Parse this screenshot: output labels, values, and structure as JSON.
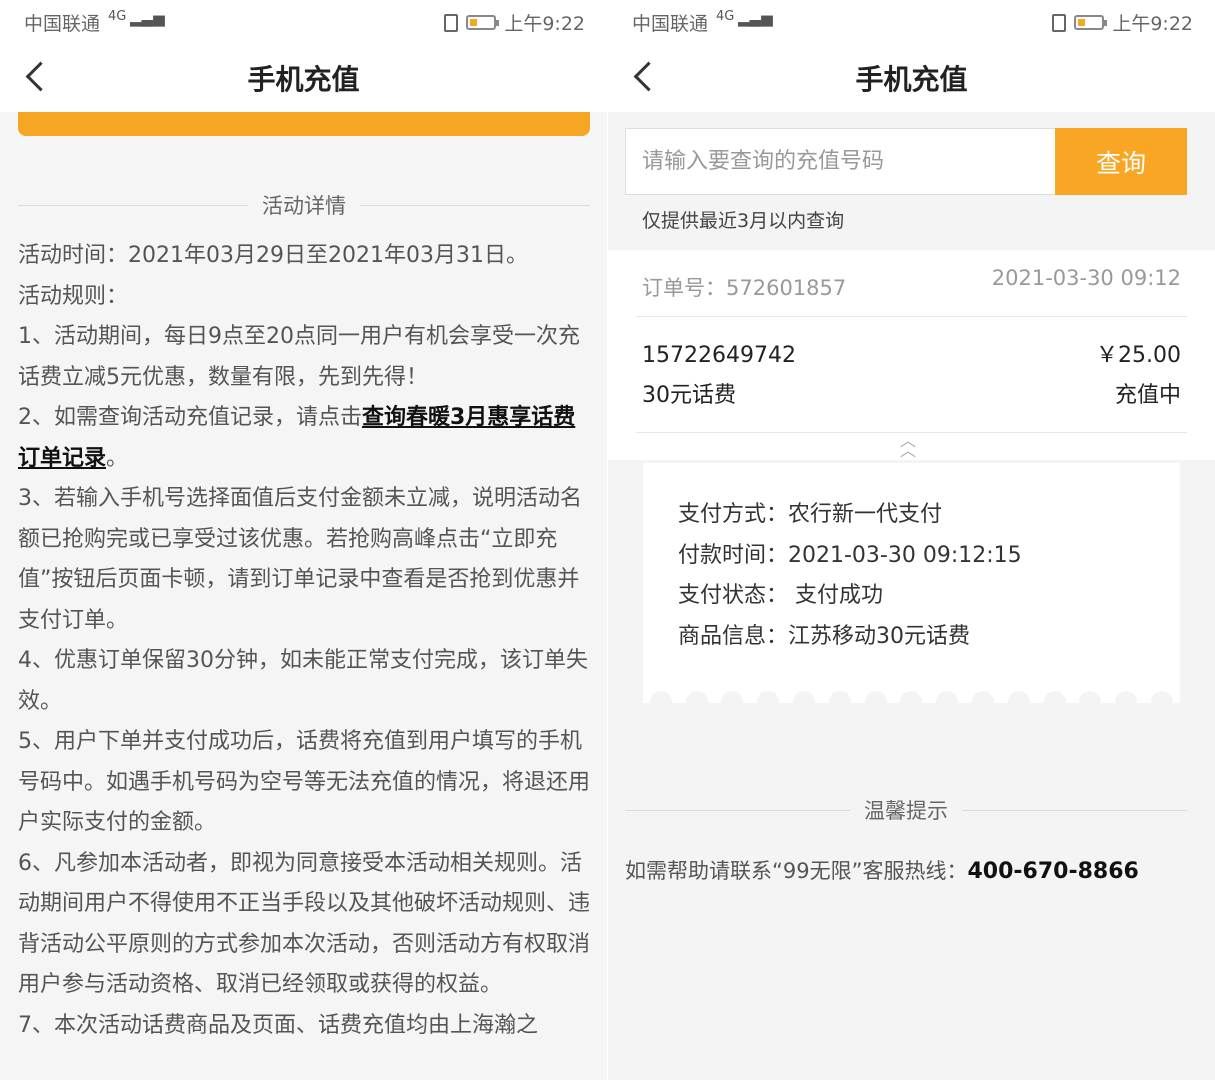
{
  "left": {
    "status": {
      "carrier": "中国联通",
      "signal": "4G",
      "time": "上午9:22"
    },
    "title": "手机充值",
    "section_title": "活动详情",
    "rules": {
      "line1": "活动时间：2021年03月29日至2021年03月31日。",
      "line2": "活动规则：",
      "rule1": "1、活动期间，每日9点至20点同一用户有机会享受一次充话费立减5元优惠，数量有限，先到先得！",
      "rule2_pre": "2、如需查询活动充值记录，请点击",
      "rule2_link": "查询春暖3月惠享话费订单记录",
      "rule2_post": "。",
      "rule3": "3、若输入手机号选择面值后支付金额未立减，说明活动名额已抢购完或已享受过该优惠。若抢购高峰点击“立即充值”按钮后页面卡顿，请到订单记录中查看是否抢到优惠并支付订单。",
      "rule4": "4、优惠订单保留30分钟，如未能正常支付完成，该订单失效。",
      "rule5": "5、用户下单并支付成功后，话费将充值到用户填写的手机号码中。如遇手机号码为空号等无法充值的情况，将退还用户实际支付的金额。",
      "rule6": "6、凡参加本活动者，即视为同意接受本活动相关规则。活动期间用户不得使用不正当手段以及其他破坏活动规则、违背活动公平原则的方式参加本次活动，否则活动方有权取消用户参与活动资格、取消已经领取或获得的权益。",
      "rule7": "7、本次活动话费商品及页面、话费充值均由上海瀚之"
    }
  },
  "right": {
    "status": {
      "carrier": "中国联通",
      "signal": "4G",
      "time": "上午9:22"
    },
    "title": "手机充值",
    "search": {
      "placeholder": "请输入要查询的充值号码",
      "button": "查询"
    },
    "hint": "仅提供最近3月以内查询",
    "order": {
      "number": "订单号：572601857",
      "time": "2021-03-30 09:12",
      "phone": "15722649742",
      "amount": "￥25.00",
      "product": "30元话费",
      "status": "充值中"
    },
    "detail": {
      "pay_method": "支付方式：农行新一代支付",
      "pay_time": "付款时间：2021-03-30 09:12:15",
      "pay_status": "支付状态： 支付成功",
      "goods": "商品信息：江苏移动30元话费"
    },
    "tips": {
      "title": "温馨提示",
      "text": "如需帮助请联系“99无限”客服热线：",
      "phone": "400-670-8866"
    }
  }
}
